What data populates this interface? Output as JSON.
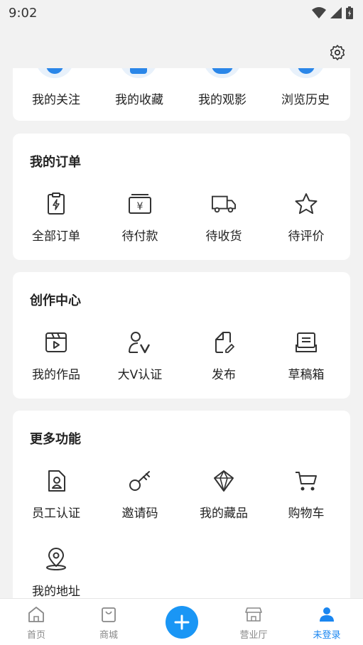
{
  "status_bar": {
    "time": "9:02"
  },
  "top_row": [
    {
      "label": "我的关注",
      "icon": "follow-icon"
    },
    {
      "label": "我的收藏",
      "icon": "favorite-icon"
    },
    {
      "label": "我的观影",
      "icon": "movie-icon"
    },
    {
      "label": "浏览历史",
      "icon": "history-icon"
    }
  ],
  "orders": {
    "title": "我的订单",
    "items": [
      {
        "label": "全部订单",
        "icon": "clipboard-bolt-icon"
      },
      {
        "label": "待付款",
        "icon": "wallet-yen-icon"
      },
      {
        "label": "待收货",
        "icon": "truck-icon"
      },
      {
        "label": "待评价",
        "icon": "star-icon"
      }
    ]
  },
  "creation": {
    "title": "创作中心",
    "items": [
      {
        "label": "我的作品",
        "icon": "video-icon"
      },
      {
        "label": "大V认证",
        "icon": "user-v-icon"
      },
      {
        "label": "发布",
        "icon": "edit-file-icon"
      },
      {
        "label": "草稿箱",
        "icon": "draft-box-icon"
      }
    ]
  },
  "more": {
    "title": "更多功能",
    "items": [
      {
        "label": "员工认证",
        "icon": "employee-badge-icon"
      },
      {
        "label": "邀请码",
        "icon": "key-icon"
      },
      {
        "label": "我的藏品",
        "icon": "diamond-icon"
      },
      {
        "label": "购物车",
        "icon": "cart-icon"
      },
      {
        "label": "我的地址",
        "icon": "location-icon"
      }
    ]
  },
  "tabs": [
    {
      "label": "首页",
      "icon": "home-icon"
    },
    {
      "label": "商城",
      "icon": "shopping-bag-icon"
    },
    {
      "label": "",
      "icon": "plus-icon"
    },
    {
      "label": "营业厅",
      "icon": "store-icon"
    },
    {
      "label": "未登录",
      "icon": "user-icon"
    }
  ],
  "colors": {
    "accent": "#1a86f0",
    "background": "#f2f2f2"
  }
}
